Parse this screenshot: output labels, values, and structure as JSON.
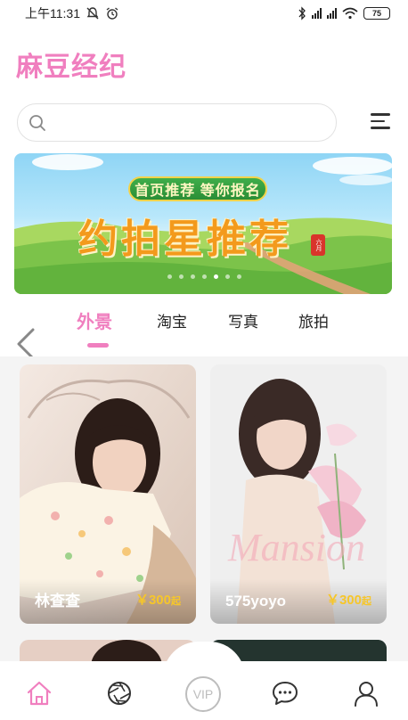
{
  "status_bar": {
    "time": "上午11:31",
    "battery": "75"
  },
  "app": {
    "title": "麻豆经纪"
  },
  "search": {
    "placeholder": ""
  },
  "banner": {
    "pill_text": "首页推荐 等你报名",
    "title": "约拍星推荐",
    "seal_text": "六月",
    "slide_count": 7,
    "active_slide": 5
  },
  "tabs": [
    {
      "label": "外景",
      "active": true
    },
    {
      "label": "淘宝",
      "active": false
    },
    {
      "label": "写真",
      "active": false
    },
    {
      "label": "旅拍",
      "active": false
    }
  ],
  "cards": [
    {
      "name": "林查查",
      "price": "￥300",
      "price_suffix": "起"
    },
    {
      "name": "575yoyo",
      "price": "￥300",
      "price_suffix": "起",
      "watermark": "Mansion"
    }
  ],
  "bottom_nav": [
    {
      "icon": "home-icon",
      "active": true
    },
    {
      "icon": "lens-icon",
      "active": false
    },
    {
      "icon": "vip-icon",
      "label": "VIP",
      "active": false
    },
    {
      "icon": "chat-icon",
      "active": false
    },
    {
      "icon": "user-icon",
      "active": false
    }
  ],
  "colors": {
    "accent": "#f07fbf",
    "price": "#f6c62a",
    "banner_title": "#f39a1c"
  }
}
